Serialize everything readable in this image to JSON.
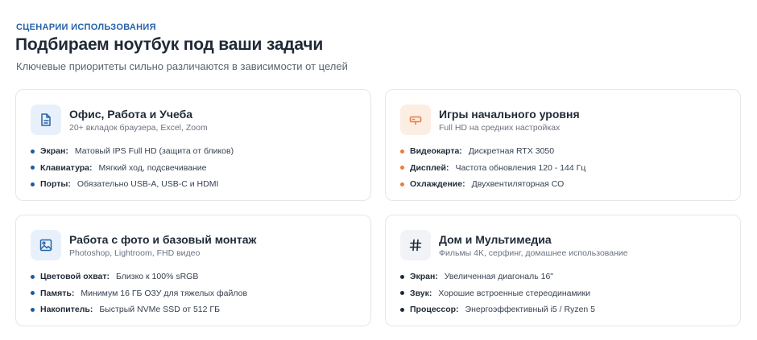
{
  "header": {
    "eyebrow": "СЦЕНАРИИ ИСПОЛЬЗОВАНИЯ",
    "title": "Подбираем ноутбук под ваши задачи",
    "subtitle": "Ключевые приоритеты сильно различаются в зависимости от целей"
  },
  "colors": {
    "accent_blue": "#2563a8",
    "accent_orange": "#f07a3a",
    "dark": "#1f2a37"
  },
  "cards": [
    {
      "icon": "document-icon",
      "title": "Офис, Работа и Учеба",
      "subtitle": "20+ вкладок браузера, Excel, Zoom",
      "specs": [
        {
          "label": "Экран:",
          "value": "Матовый IPS Full HD (защита от бликов)"
        },
        {
          "label": "Клавиатура:",
          "value": "Мягкий ход, подсвечивание"
        },
        {
          "label": "Порты:",
          "value": "Обязательно USB-A, USB-C и HDMI"
        }
      ]
    },
    {
      "icon": "gamepad-icon",
      "title": "Игры начального уровня",
      "subtitle": "Full HD на средних настройках",
      "specs": [
        {
          "label": "Видеокарта:",
          "value": "Дискретная RTX 3050"
        },
        {
          "label": "Дисплей:",
          "value": "Частота обновления 120 - 144 Гц"
        },
        {
          "label": "Охлаждение:",
          "value": "Двухвентиляторная СО"
        }
      ]
    },
    {
      "icon": "image-icon",
      "title": "Работа с фото и базовый монтаж",
      "subtitle": "Photoshop, Lightroom, FHD видео",
      "specs": [
        {
          "label": "Цветовой охват:",
          "value": "Близко к 100% sRGB"
        },
        {
          "label": "Память:",
          "value": "Минимум 16 ГБ ОЗУ для тяжелых файлов"
        },
        {
          "label": "Накопитель:",
          "value": "Быстрый NVMe SSD от 512 ГБ"
        }
      ]
    },
    {
      "icon": "hash-icon",
      "title": "Дом и Мультимедиа",
      "subtitle": "Фильмы 4K, серфинг, домашнее использование",
      "specs": [
        {
          "label": "Экран:",
          "value": "Увеличенная диагональ 16\""
        },
        {
          "label": "Звук:",
          "value": "Хорошие встроенные стереодинамики"
        },
        {
          "label": "Процессор:",
          "value": "Энергоэффективный i5 / Ryzen 5"
        }
      ]
    }
  ]
}
